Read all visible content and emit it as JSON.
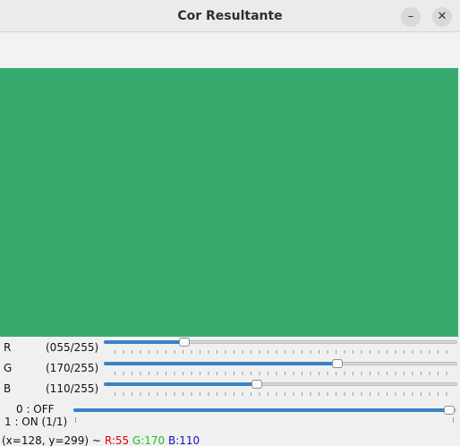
{
  "window": {
    "title": "Cor Resultante"
  },
  "canvas": {
    "color": "#37AB6E"
  },
  "sliders": [
    {
      "name": "R",
      "value_text": "(055/255)",
      "value": 55,
      "max": 255
    },
    {
      "name": "G",
      "value_text": "(170/255)",
      "value": 170,
      "max": 255
    },
    {
      "name": "B",
      "value_text": "(110/255)",
      "value": 110,
      "max": 255
    }
  ],
  "switch": {
    "off_label": "0 : OFF",
    "on_label": "1 : ON (1/1)",
    "value": 1
  },
  "status": {
    "coords": "(x=128, y=299) ~",
    "r": "R:55",
    "g": "G:170",
    "b": "B:110"
  },
  "colors": {
    "accent": "#3B82C4",
    "red": "#E00000",
    "green": "#22C022",
    "blue": "#1010C8"
  }
}
